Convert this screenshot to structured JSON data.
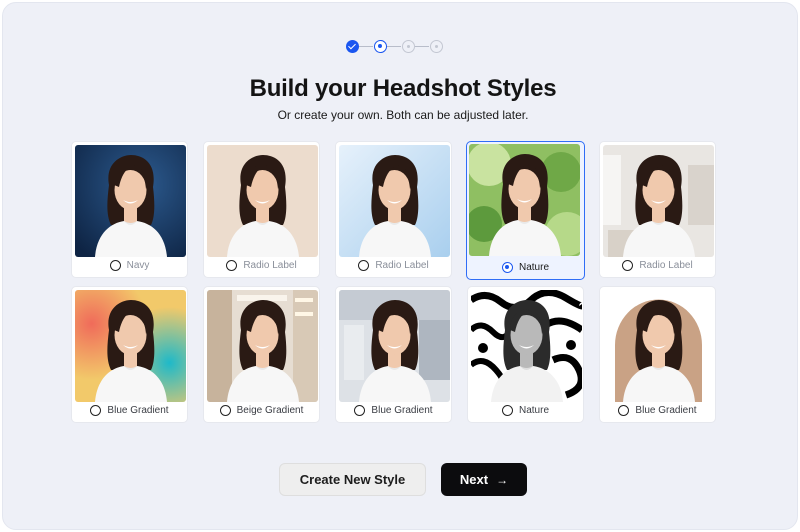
{
  "stepper": {
    "steps": [
      {
        "state": "done"
      },
      {
        "state": "current"
      },
      {
        "state": "todo"
      },
      {
        "state": "todo"
      }
    ],
    "accent": "#1a56f0"
  },
  "header": {
    "title": "Build your Headshot Styles",
    "subtitle": "Or create your own. Both can be adjusted later."
  },
  "styles": [
    {
      "label": "Navy",
      "background": "navy",
      "selected": false
    },
    {
      "label": "Radio Label",
      "background": "beige",
      "selected": false
    },
    {
      "label": "Radio Label",
      "background": "light-blue",
      "selected": false
    },
    {
      "label": "Nature",
      "background": "nature",
      "selected": true
    },
    {
      "label": "Radio Label",
      "background": "office-blur",
      "selected": false
    },
    {
      "label": "Blue Gradient",
      "background": "colorful-gradient",
      "selected": false
    },
    {
      "label": "Beige Gradient",
      "background": "hallway",
      "selected": false
    },
    {
      "label": "Blue Gradient",
      "background": "office",
      "selected": false
    },
    {
      "label": "Nature",
      "background": "black-white-pattern",
      "selected": false
    },
    {
      "label": "Blue Gradient",
      "background": "arch",
      "selected": false
    }
  ],
  "actions": {
    "create_label": "Create New Style",
    "next_label": "Next",
    "next_icon": "arrow-right-icon"
  }
}
